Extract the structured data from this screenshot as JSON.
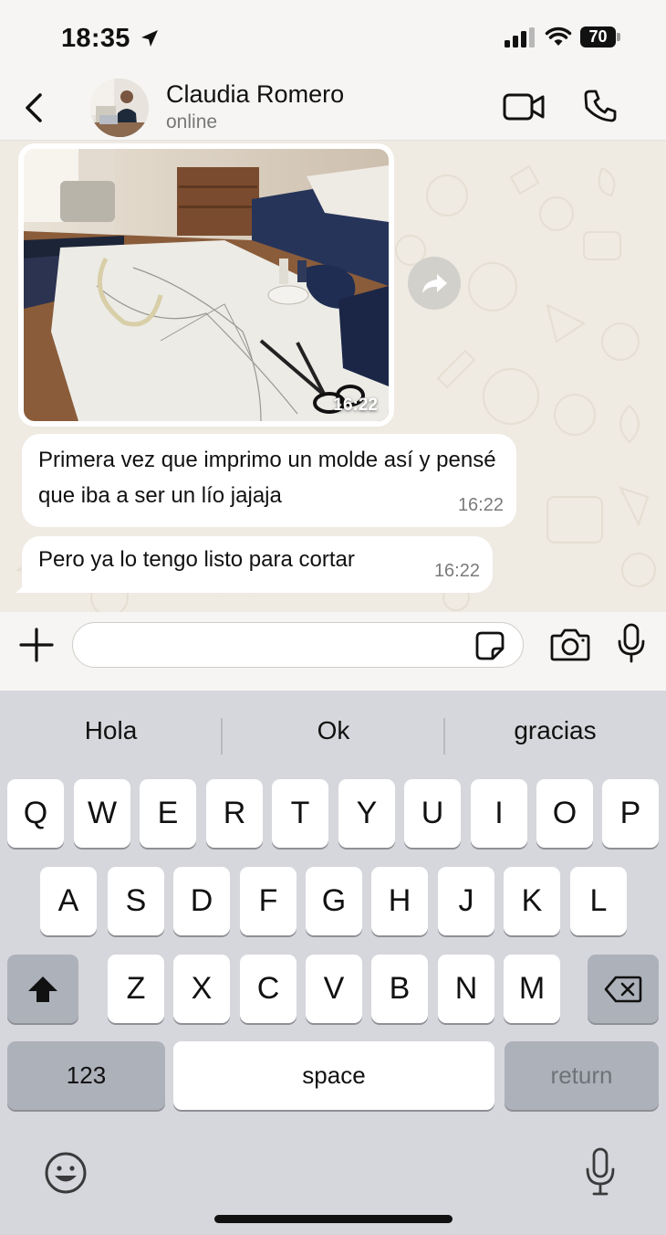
{
  "status_bar": {
    "time": "18:35",
    "battery": "70",
    "icons": [
      "location-arrow-icon",
      "signal-icon",
      "wifi-icon",
      "battery-icon"
    ]
  },
  "header": {
    "contact_name": "Claudia Romero",
    "contact_status": "online",
    "icons": [
      "back-icon",
      "avatar",
      "video-call-icon",
      "phone-icon"
    ]
  },
  "messages": [
    {
      "type": "image",
      "time": "16:22"
    },
    {
      "type": "text",
      "text": "Primera vez que imprimo un molde así y pensé que iba a ser un lío jajaja",
      "time": "16:22"
    },
    {
      "type": "text",
      "text": "Pero ya lo tengo listo para cortar",
      "time": "16:22"
    }
  ],
  "input_bar": {
    "placeholder": "",
    "icons": [
      "plus-icon",
      "sticker-icon",
      "camera-icon",
      "microphone-icon"
    ]
  },
  "keyboard": {
    "suggestions": [
      "Hola",
      "Ok",
      "gracias"
    ],
    "row1": [
      "Q",
      "W",
      "E",
      "R",
      "T",
      "Y",
      "U",
      "I",
      "O",
      "P"
    ],
    "row2": [
      "A",
      "S",
      "D",
      "F",
      "G",
      "H",
      "J",
      "K",
      "L"
    ],
    "row3": [
      "Z",
      "X",
      "C",
      "V",
      "B",
      "N",
      "M"
    ],
    "numbers_label": "123",
    "space_label": "space",
    "return_label": "return",
    "icons": [
      "shift-icon",
      "backspace-icon",
      "emoji-icon",
      "dictation-icon"
    ]
  },
  "colors": {
    "chat_background": "#efeae2",
    "bubble_incoming": "#ffffff",
    "keyboard_background": "#d6d7dc"
  }
}
